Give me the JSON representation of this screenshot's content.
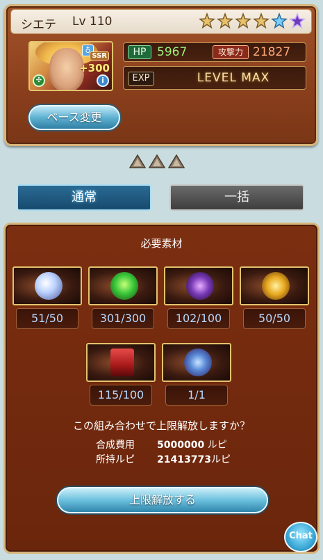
{
  "character": {
    "name": "シエテ",
    "level_label": "Lv 110",
    "stars_filled": 4,
    "stars_total": 6,
    "rarity": "SSR",
    "plus_bonus": "+300",
    "element": "wind",
    "hp_label": "HP",
    "hp_value": "5967",
    "atk_label": "攻撃力",
    "atk_value": "21827",
    "exp_label": "EXP",
    "exp_status": "LEVEL MAX",
    "base_change_label": "ベース変更"
  },
  "mode_tabs": {
    "normal": "通常",
    "bulk": "一括"
  },
  "materials": {
    "title": "必要素材",
    "items": [
      {
        "count": "51/50"
      },
      {
        "count": "301/300"
      },
      {
        "count": "102/100"
      },
      {
        "count": "50/50"
      },
      {
        "count": "115/100"
      },
      {
        "count": "1/1"
      }
    ]
  },
  "confirm": {
    "question": "この組み合わせで上限解放しますか？",
    "cost_label": "合成費用",
    "cost_value": "5000000",
    "rupi_label": "所持ルピ",
    "rupi_value": "21413773",
    "unit": "ルピ",
    "button_label": "上限解放する"
  },
  "chat_label": "Chat",
  "colors": {
    "panel_brown": "#7c2e10",
    "gold_border": "#d7b47a",
    "hp_green": "#9ef07a",
    "atk_orange": "#ffa878",
    "count_blue": "#b8d8ff",
    "button_blue": "#5fb2d2"
  }
}
